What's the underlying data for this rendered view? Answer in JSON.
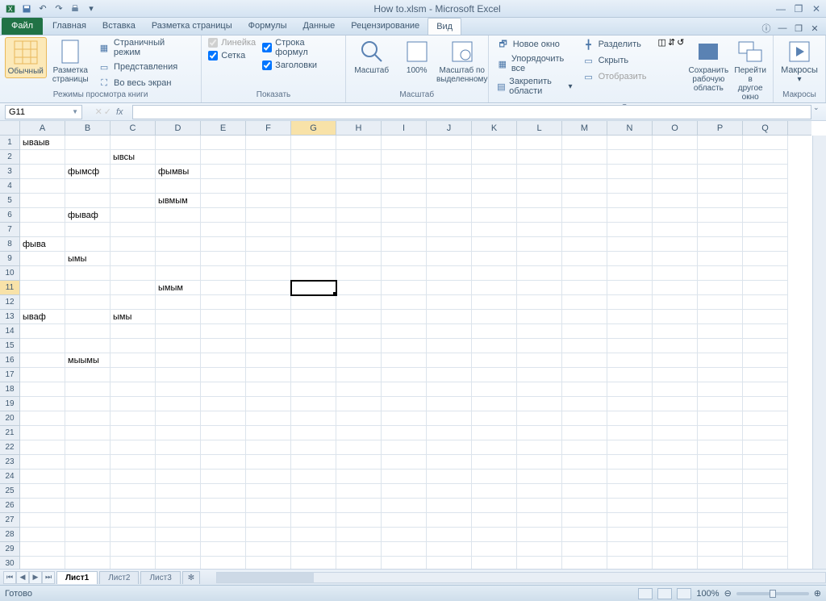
{
  "title": "How to.xlsm  -  Microsoft Excel",
  "tabs": {
    "file": "Файл",
    "home": "Главная",
    "insert": "Вставка",
    "pagelayout": "Разметка страницы",
    "formulas": "Формулы",
    "data": "Данные",
    "review": "Рецензирование",
    "view": "Вид"
  },
  "ribbon": {
    "views": {
      "normal": "Обычный",
      "pagelayout": "Разметка\nстраницы",
      "pagebreak": "Страничный режим",
      "custom": "Представления",
      "fullscreen": "Во весь экран",
      "group": "Режимы просмотра книги"
    },
    "show": {
      "ruler": "Линейка",
      "formulabar": "Строка формул",
      "gridlines": "Сетка",
      "headings": "Заголовки",
      "group": "Показать"
    },
    "zoom": {
      "zoom": "Масштаб",
      "z100": "100%",
      "zsel": "Масштаб по\nвыделенному",
      "group": "Масштаб"
    },
    "window": {
      "newwin": "Новое окно",
      "arrange": "Упорядочить все",
      "freeze": "Закрепить области",
      "split": "Разделить",
      "hide": "Скрыть",
      "unhide": "Отобразить",
      "save": "Сохранить\nрабочую область",
      "switch": "Перейти в\nдругое окно",
      "group": "Окно"
    },
    "macros": {
      "macros": "Макросы",
      "group": "Макросы"
    }
  },
  "namebox": "G11",
  "columns": [
    "A",
    "B",
    "C",
    "D",
    "E",
    "F",
    "G",
    "H",
    "I",
    "J",
    "K",
    "L",
    "M",
    "N",
    "O",
    "P",
    "Q"
  ],
  "rowcount": 30,
  "active": {
    "col": "G",
    "row": 11
  },
  "cells": {
    "A1": "ываыв",
    "C2": "ывсы",
    "B3": "фымсф",
    "D3": "фымвы",
    "D5": "ывмым",
    "B6": "фываф",
    "A8": "фыва",
    "B9": "ымы",
    "D11": "ымым",
    "A13": "ываф",
    "C13": "ымы",
    "B16": "мыымы"
  },
  "sheets": {
    "s1": "Лист1",
    "s2": "Лист2",
    "s3": "Лист3"
  },
  "status": "Готово",
  "zoom": "100%"
}
